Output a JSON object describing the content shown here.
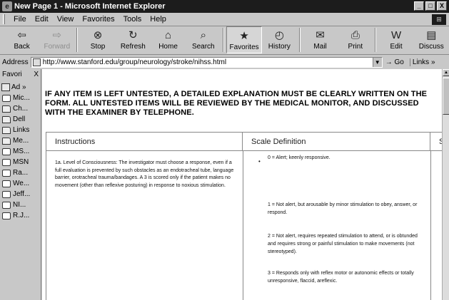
{
  "window": {
    "title": "New Page 1 - Microsoft Internet Explorer",
    "logo": "e",
    "buttons": [
      "_",
      "□",
      "X"
    ]
  },
  "menu": [
    "File",
    "Edit",
    "View",
    "Favorites",
    "Tools",
    "Help"
  ],
  "toolbar": [
    {
      "label": "Back",
      "icon": "⇦",
      "disabled": false,
      "active": false
    },
    {
      "label": "Forward",
      "icon": "⇨",
      "disabled": true,
      "active": false
    },
    {
      "label": "Stop",
      "icon": "⊗",
      "disabled": false,
      "active": false
    },
    {
      "label": "Refresh",
      "icon": "↻",
      "disabled": false,
      "active": false
    },
    {
      "label": "Home",
      "icon": "⌂",
      "disabled": false,
      "active": false
    },
    {
      "label": "Search",
      "icon": "⌕",
      "disabled": false,
      "active": false
    },
    {
      "label": "Favorites",
      "icon": "★",
      "disabled": false,
      "active": true
    },
    {
      "label": "History",
      "icon": "◴",
      "disabled": false,
      "active": false
    },
    {
      "label": "Mail",
      "icon": "✉",
      "disabled": false,
      "active": false
    },
    {
      "label": "Print",
      "icon": "⎙",
      "disabled": false,
      "active": false
    },
    {
      "label": "Edit",
      "icon": "W",
      "disabled": false,
      "active": false
    },
    {
      "label": "Discuss",
      "icon": "▤",
      "disabled": false,
      "active": false
    }
  ],
  "address": {
    "label": "Address",
    "url": "http://www.stanford.edu/group/neurology/stroke/nihss.html",
    "go": "Go",
    "links": "Links"
  },
  "favorites": {
    "title": "Favori",
    "close": "X",
    "toolbar_label": "Ad",
    "items": [
      {
        "label": "Mic...",
        "type": "page"
      },
      {
        "label": "Ch...",
        "type": "folder"
      },
      {
        "label": "Dell",
        "type": "folder"
      },
      {
        "label": "Links",
        "type": "folder"
      },
      {
        "label": "Me...",
        "type": "folder"
      },
      {
        "label": "MS...",
        "type": "page"
      },
      {
        "label": "MSN",
        "type": "page"
      },
      {
        "label": "Ra...",
        "type": "page"
      },
      {
        "label": "We...",
        "type": "page"
      },
      {
        "label": "Jeff...",
        "type": "page"
      },
      {
        "label": "NI...",
        "type": "page"
      },
      {
        "label": "R.J...",
        "type": "page"
      }
    ]
  },
  "content": {
    "warning": "IF ANY ITEM IS LEFT UNTESTED, A DETAILED EXPLANATION MUST BE CLEARLY WRITTEN ON THE FORM. ALL UNTESTED ITEMS WILL BE REVIEWED BY THE MEDICAL MONITOR, AND DISCUSSED WITH THE EXAMINER BY TELEPHONE.",
    "table": {
      "headers": [
        "Instructions",
        "Scale Definition",
        "Sc"
      ],
      "instruction": "1a. Level of Consciousness: The investigator must choose a response, even if a full evaluation is prevented by such obstacles as an endotracheal tube, language barrier, orotracheal trauma/bandages. A 3 is scored only if the patient makes no movement (other than reflexive posturing) in response to noxious stimulation.",
      "scale": [
        "0 = Alert; keenly responsive.",
        "1 = Not alert, but arousable by minor stimulation to obey, answer, or respond.",
        "2 = Not alert, requires repeated stimulation to attend, or is obtunded and requires strong or painful stimulation to make movements (not stereotyped).",
        "3 = Responds only with reflex motor or autonomic effects or totally unresponsive, flaccid, areflexic."
      ]
    }
  }
}
